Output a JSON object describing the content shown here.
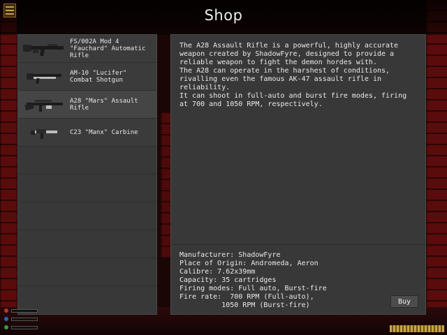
{
  "title": "Shop",
  "shop_items": [
    {
      "label": "FS/002A Mod 4\n\"Fauchard\" Automatic\nRifle",
      "icon": "rifle-icon"
    },
    {
      "label": "AM-10 \"Lucifer\"\nCombat Shotgun",
      "icon": "shotgun-icon"
    },
    {
      "label": "A28 \"Mars\" Assault\nRifle",
      "icon": "assault-rifle-icon"
    },
    {
      "label": "C23 \"Manx\" Carbine",
      "icon": "carbine-icon"
    }
  ],
  "selected_item": {
    "description": "The A28 Assault Rifle is a powerful, highly accurate\nweapon created by ShadowFyre, designed to provide a\nreliable weapon to fight the demon hordes with.\nThe A28 can operate in the harshest of conditions,\nrivalling even the famous AK-47 assault rifle in\nreliability.\nIt can shoot in full-auto and burst fire modes, firing\nat 700 and 1050 RPM, respectively.",
    "specs": {
      "manufacturer": "Manufacturer: ShadowFyre",
      "origin": "Place of Origin: Andromeda, Aeron",
      "calibre": "Calibre: 7.62x39mm",
      "capacity": "Capacity: 35 cartridges",
      "firing_modes": "Firing modes: Full auto, Burst-fire",
      "fire_rate": "Fire rate:  700 RPM (Full-auto),\n          1050 RPM (Burst-fire)"
    }
  },
  "buy_label": "Buy",
  "colors": {
    "panel": "#3a3a3a",
    "text": "#eaeaea",
    "wall": "#5a0c0c",
    "ammo": "#c9a443"
  }
}
